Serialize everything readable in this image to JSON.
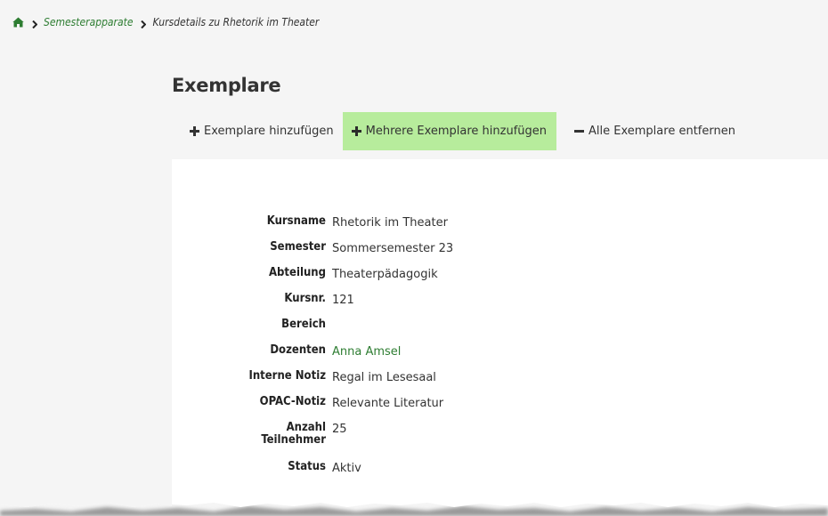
{
  "breadcrumb": {
    "home_icon": "home-icon",
    "items": [
      {
        "label": "Semesterapparate"
      },
      {
        "label": "Kursdetails zu Rhetorik im Theater"
      }
    ]
  },
  "section": {
    "title": "Exemplare"
  },
  "toolbar": {
    "add_label": "Exemplare hinzufügen",
    "add_multiple_label": "Mehrere Exemplare hinzufügen",
    "remove_all_label": "Alle Exemplare entfernen"
  },
  "details": {
    "kursname_label": "Kursname",
    "kursname_value": "Rhetorik im Theater",
    "semester_label": "Semester",
    "semester_value": "Sommersemester 23",
    "abteilung_label": "Abteilung",
    "abteilung_value": "Theaterpädagogik",
    "kursnr_label": "Kursnr.",
    "kursnr_value": "121",
    "bereich_label": "Bereich",
    "bereich_value": "",
    "dozenten_label": "Dozenten",
    "dozenten_value": "Anna Amsel",
    "notiz_label": "Interne Notiz",
    "notiz_value": "Regal im Lesesaal",
    "opac_label": "OPAC-Notiz",
    "opac_value": "Relevante Literatur",
    "anzahl_label_1": "Anzahl",
    "anzahl_label_2": "Teilnehmer",
    "anzahl_value": "25",
    "status_label": "Status",
    "status_value": "Aktiv"
  },
  "colors": {
    "link": "#2e7d32",
    "active_button": "#b7ec9c",
    "background": "#f5f5f5",
    "panel": "#ffffff"
  }
}
